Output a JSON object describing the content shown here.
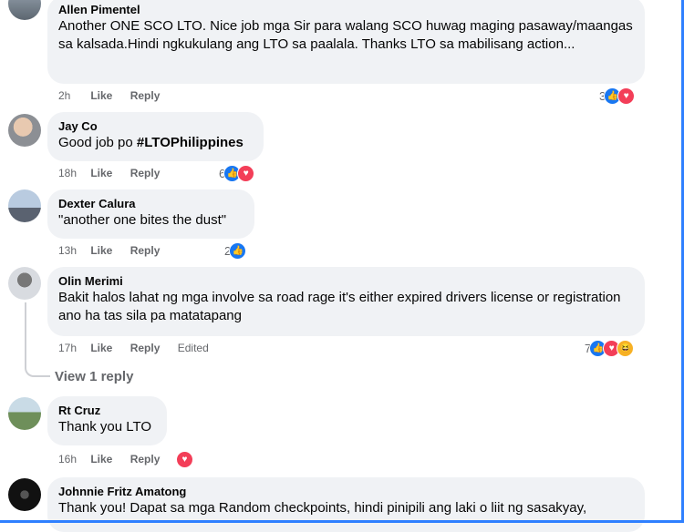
{
  "actions": {
    "like_label": "Like",
    "reply_label": "Reply",
    "edited_label": "Edited"
  },
  "comments": [
    {
      "name": "Allen Pimentel",
      "text": "Another ONE SCO LTO. Nice job mga Sir para walang SCO huwag maging pasaway/maangas sa kalsada.Hindi ngkukulang ang LTO sa paalala. Thanks LTO sa mabilisang action...",
      "time": "2h",
      "reaction_count": "3",
      "reactions": [
        "like-icon",
        "love-icon"
      ]
    },
    {
      "name": "Jay Co",
      "text_prefix": "Good job po ",
      "hashtag": "#LTOPhilippines",
      "time": "18h",
      "reaction_count": "6",
      "reactions": [
        "like-icon",
        "love-icon"
      ]
    },
    {
      "name": "Dexter Calura",
      "text": "\"another one bites the dust\"",
      "time": "13h",
      "reaction_count": "2",
      "reactions": [
        "like-icon"
      ]
    },
    {
      "name": "Olin Merimi",
      "text": "Bakit halos lahat ng mga involve sa road rage it's either expired drivers license or registration ano ha tas sila pa matatapang",
      "time": "17h",
      "edited": true,
      "reaction_count": "7",
      "reactions": [
        "like-icon",
        "love-icon",
        "haha-icon"
      ],
      "view_replies_label": "View 1 reply"
    },
    {
      "name": "Rt Cruz",
      "text": "Thank you LTO",
      "time": "16h",
      "reaction_count": "",
      "reactions": [
        "love-icon"
      ]
    },
    {
      "name": "Johnnie Fritz Amatong",
      "text": "Thank you! Dapat sa mga Random checkpoints, hindi pinipili ang laki o liit ng sasakyay,"
    }
  ],
  "colors": {
    "bubble": "#f0f2f5",
    "meta_text": "#65676b",
    "like_blue": "#1877f2",
    "love_red": "#f33e58",
    "haha_yellow": "#f7b125",
    "frame_blue": "#2f80ff"
  }
}
